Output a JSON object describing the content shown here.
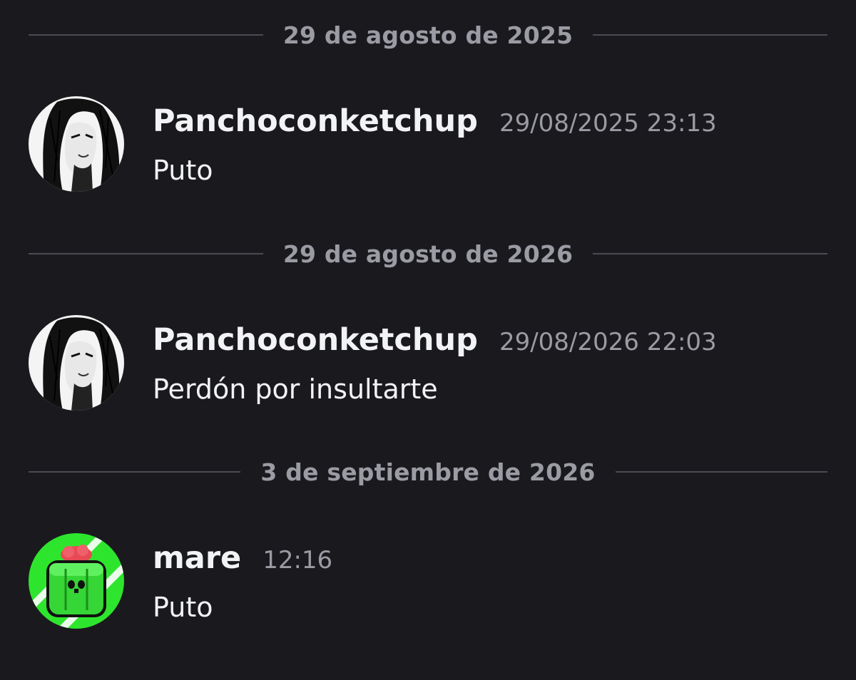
{
  "colors": {
    "background": "#1a1a1e",
    "divider_line": "#4a4b52",
    "muted_text": "#9a9ba3",
    "primary_text": "#f2f3f5",
    "avatar_green": "#2ee52e"
  },
  "dividers": [
    {
      "date": "29 de agosto de 2025"
    },
    {
      "date": "29 de agosto de 2026"
    },
    {
      "date": "3 de septiembre de 2026"
    }
  ],
  "messages": [
    {
      "username": "Panchoconketchup",
      "timestamp": "29/08/2025 23:13",
      "text": "Puto",
      "avatar_icon": "sketch-portrait-avatar"
    },
    {
      "username": "Panchoconketchup",
      "timestamp": "29/08/2026 22:03",
      "text": "Perdón por insultarte",
      "avatar_icon": "sketch-portrait-avatar"
    },
    {
      "username": "mare",
      "timestamp": "12:16",
      "text": "Puto",
      "avatar_icon": "green-cactus-avatar"
    }
  ]
}
